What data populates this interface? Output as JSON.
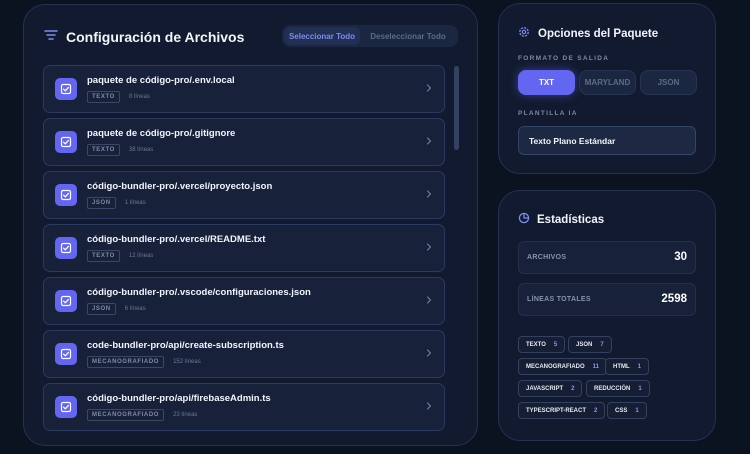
{
  "files_panel": {
    "title": "Configuración de Archivos",
    "select_all": "Seleccionar Todo",
    "deselect_all": "Deseleccionar Todo",
    "items": [
      {
        "path": "paquete de código-pro/.env.local",
        "tag": "TEXTO",
        "lines": "8 líneas"
      },
      {
        "path": "paquete de código-pro/.gitignore",
        "tag": "TEXTO",
        "lines": "38 líneas"
      },
      {
        "path": "código-bundler-pro/.vercel/proyecto.json",
        "tag": "JSON",
        "lines": "1 líneas"
      },
      {
        "path": "código-bundler-pro/.vercel/README.txt",
        "tag": "TEXTO",
        "lines": "12 líneas"
      },
      {
        "path": "código-bundler-pro/.vscode/configuraciones.json",
        "tag": "JSON",
        "lines": "6 líneas"
      },
      {
        "path": "code-bundler-pro/api/create-subscription.ts",
        "tag": "MECANOGRAFIADO",
        "lines": "152 líneas"
      },
      {
        "path": "código-bundler-pro/api/firebaseAdmin.ts",
        "tag": "MECANOGRAFIADO",
        "lines": "23 líneas"
      }
    ]
  },
  "options_panel": {
    "title": "Opciones del Paquete",
    "output_format_label": "FORMATO DE SALIDA",
    "formats": [
      "TXT",
      "MARYLAND",
      "JSON"
    ],
    "active_format": "TXT",
    "template_label": "PLANTILLA IA",
    "template_value": "Texto Plano Estándar"
  },
  "stats_panel": {
    "title": "Estadísticas",
    "files_label": "ARCHIVOS",
    "files_value": "30",
    "lines_label": "LÍNEAS TOTALES",
    "lines_value": "2598",
    "extensions": [
      {
        "name": "TEXTO",
        "count": "5"
      },
      {
        "name": "JSON",
        "count": "7"
      },
      {
        "name": "MECANOGRAFIADO",
        "count": "11"
      },
      {
        "name": "HTML",
        "count": "1"
      },
      {
        "name": "JAVASCRIPT",
        "count": "2"
      },
      {
        "name": "REDUCCIÓN",
        "count": "1"
      },
      {
        "name": "TYPESCRIPT-REACT",
        "count": "2"
      },
      {
        "name": "CSS",
        "count": "1"
      }
    ]
  },
  "colors": {
    "accent": "#6366f1",
    "background": "#0b1220",
    "panel": "#111a2e"
  }
}
